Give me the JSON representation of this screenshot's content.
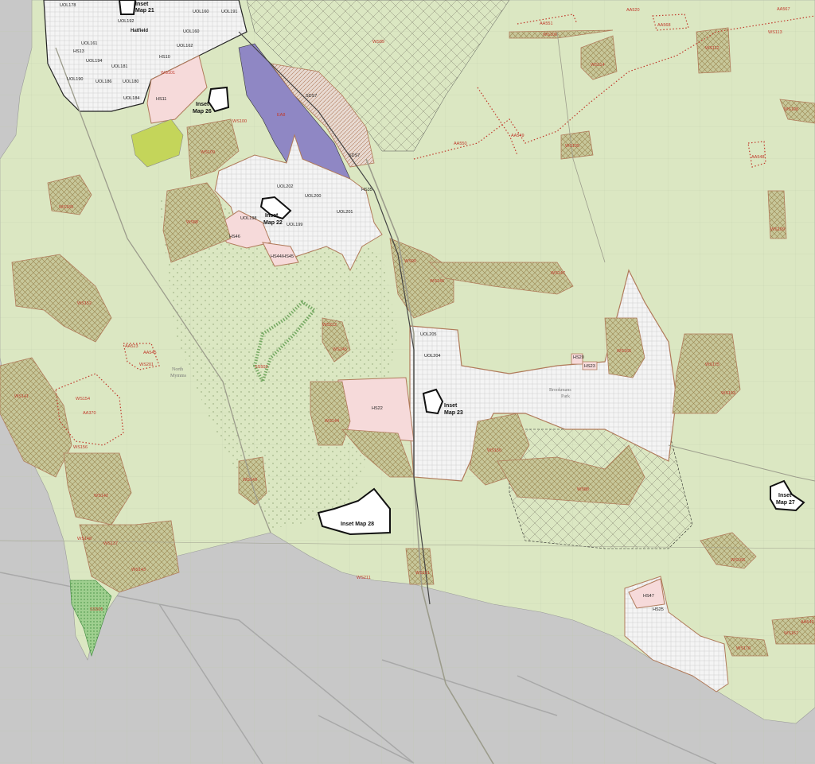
{
  "colors": {
    "greenbelt": "#dbe7c2",
    "urban": "#ffffff",
    "outside": "#c8c8c8",
    "allocation_outline": "#b07a5a",
    "allocation_fill": "#f6dada",
    "employment": "#8f87c4",
    "open_land": "#c4d55a",
    "wildlife_site": "#b7a25b",
    "label_red": "#c0392b"
  },
  "inset_maps": {
    "m21": {
      "line1": "Inset",
      "line2": "Map 21"
    },
    "m26": {
      "line1": "Inset",
      "line2": "Map 26"
    },
    "m22": {
      "line1": "Inset",
      "line2": "Map 22"
    },
    "m23": {
      "line1": "Inset",
      "line2": "Map 23"
    },
    "m27": {
      "line1": "Inset",
      "line2": "Map 27"
    },
    "m28": {
      "line1": "Inset Map 28"
    }
  },
  "places": {
    "hatfield": "Hatfield",
    "north_mymms_1": "North",
    "north_mymms_2": "Mymms",
    "brookmans_park_1": "Brookmans",
    "brookmans_park_2": "Park"
  },
  "uol": {
    "u178": "UOL178",
    "u192": "UOL192",
    "u160a": "UOL160",
    "u191": "UOL191",
    "u160b": "UOL160",
    "u162": "UOL162",
    "u161": "UOL161",
    "u194": "UOL194",
    "u181": "UOL181",
    "u190": "UOL190",
    "u186": "UOL186",
    "u180": "UOL180",
    "u184": "UOL184",
    "u202": "UOL202",
    "u200": "UOL200",
    "u201": "UOL201",
    "u198": "UOL198",
    "u199": "UOL199",
    "u205": "UOL205",
    "u204": "UOL204"
  },
  "hs": {
    "hs13": "HS13",
    "hs10": "HS10",
    "hs11": "HS11",
    "hs46": "HS46",
    "hs44": "HS44/HS45",
    "hs35": "HS35",
    "hs22": "HS22",
    "hs20": "HS20",
    "hs23": "HS23",
    "hs47": "HS47",
    "hs25": "HS25",
    "sds7a": "SDS7",
    "sds7b": "SDS7",
    "ea8": "EA8"
  },
  "ws": {
    "w101": "WS101",
    "w100": "WS100",
    "w109a": "WS109",
    "w88": "WS88",
    "w189": "WS189",
    "w89": "WS89",
    "w90": "WS90",
    "w146": "WS146",
    "w152": "WS152",
    "w141": "WS141",
    "w154": "WS154",
    "w156": "WS156",
    "w201": "WS201",
    "w212": "WS212",
    "w145": "WS145",
    "w144": "WS144",
    "w149": "WS149",
    "w150": "WS150",
    "w142": "WS142",
    "w148": "WS148",
    "w137": "WS137",
    "w143": "WS143",
    "w211": "WS211",
    "w151": "WS151",
    "w88b": "WS88",
    "w165": "WS165",
    "w175": "WS175",
    "w163": "WS163",
    "w166": "WS166",
    "w167": "WS167",
    "w176": "WS176",
    "w114": "WS114",
    "w112": "WS112",
    "w113": "WS113",
    "w108": "WS108",
    "w105": "WS105",
    "w109b": "WS109",
    "w106": "WS106",
    "w147": "WS147"
  },
  "aa": {
    "a551": "AA551",
    "a550": "AA550",
    "a549": "AA549",
    "a520": "AA520",
    "a567": "AA567",
    "a568": "AA568",
    "a548": "AA548",
    "a523": "AA523",
    "a370": "AA370",
    "a543": "AA543",
    "a545": "AA545"
  },
  "ss": {
    "s503": "SS503",
    "s505": "SS505"
  }
}
